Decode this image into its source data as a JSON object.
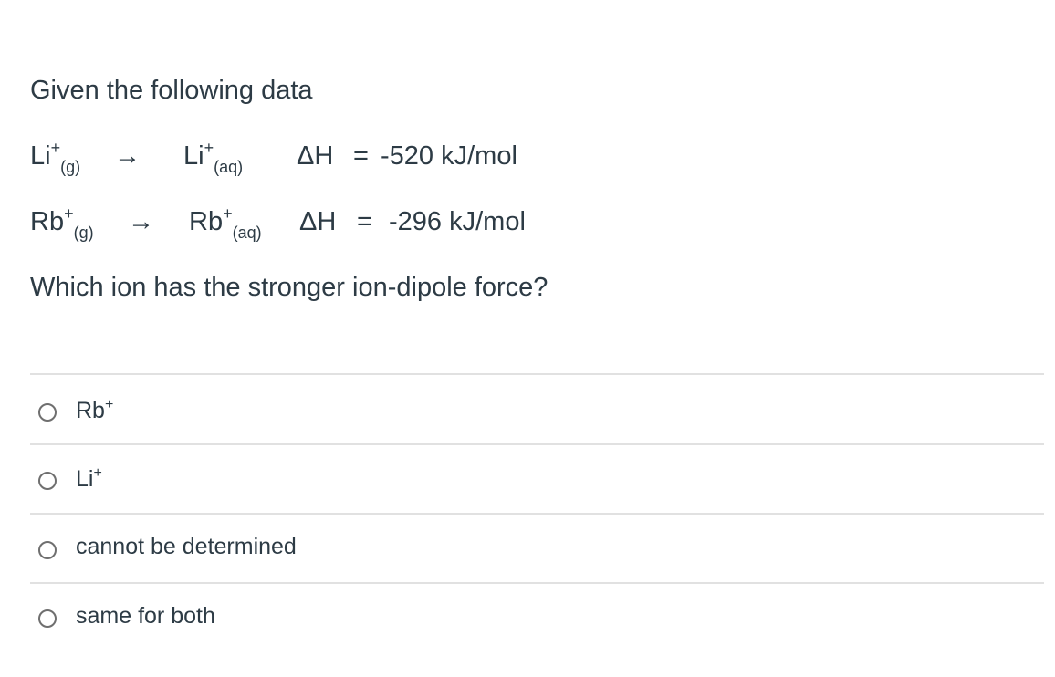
{
  "question": {
    "intro": "Given the following data",
    "equations": [
      {
        "reactant_symbol": "Li",
        "reactant_charge": "+",
        "reactant_state": "(g)",
        "arrow": "→",
        "product_symbol": "Li",
        "product_charge": "+",
        "product_state": "(aq)",
        "enthalpy_label": "ΔH",
        "equals": "=",
        "enthalpy_value": "-520 kJ/mol"
      },
      {
        "reactant_symbol": "Rb",
        "reactant_charge": "+",
        "reactant_state": "(g)",
        "arrow": "→",
        "product_symbol": "Rb",
        "product_charge": "+",
        "product_state": "(aq)",
        "enthalpy_label": "ΔH",
        "equals": "=",
        "enthalpy_value": "-296 kJ/mol"
      }
    ],
    "prompt": "Which ion has the stronger ion-dipole force?"
  },
  "answers": [
    {
      "symbol": "Rb",
      "charge": "+",
      "selected": false
    },
    {
      "symbol": "Li",
      "charge": "+",
      "selected": false
    },
    {
      "symbol": "cannot be determined",
      "charge": "",
      "selected": false
    },
    {
      "symbol": "same for both",
      "charge": "",
      "selected": false
    }
  ]
}
